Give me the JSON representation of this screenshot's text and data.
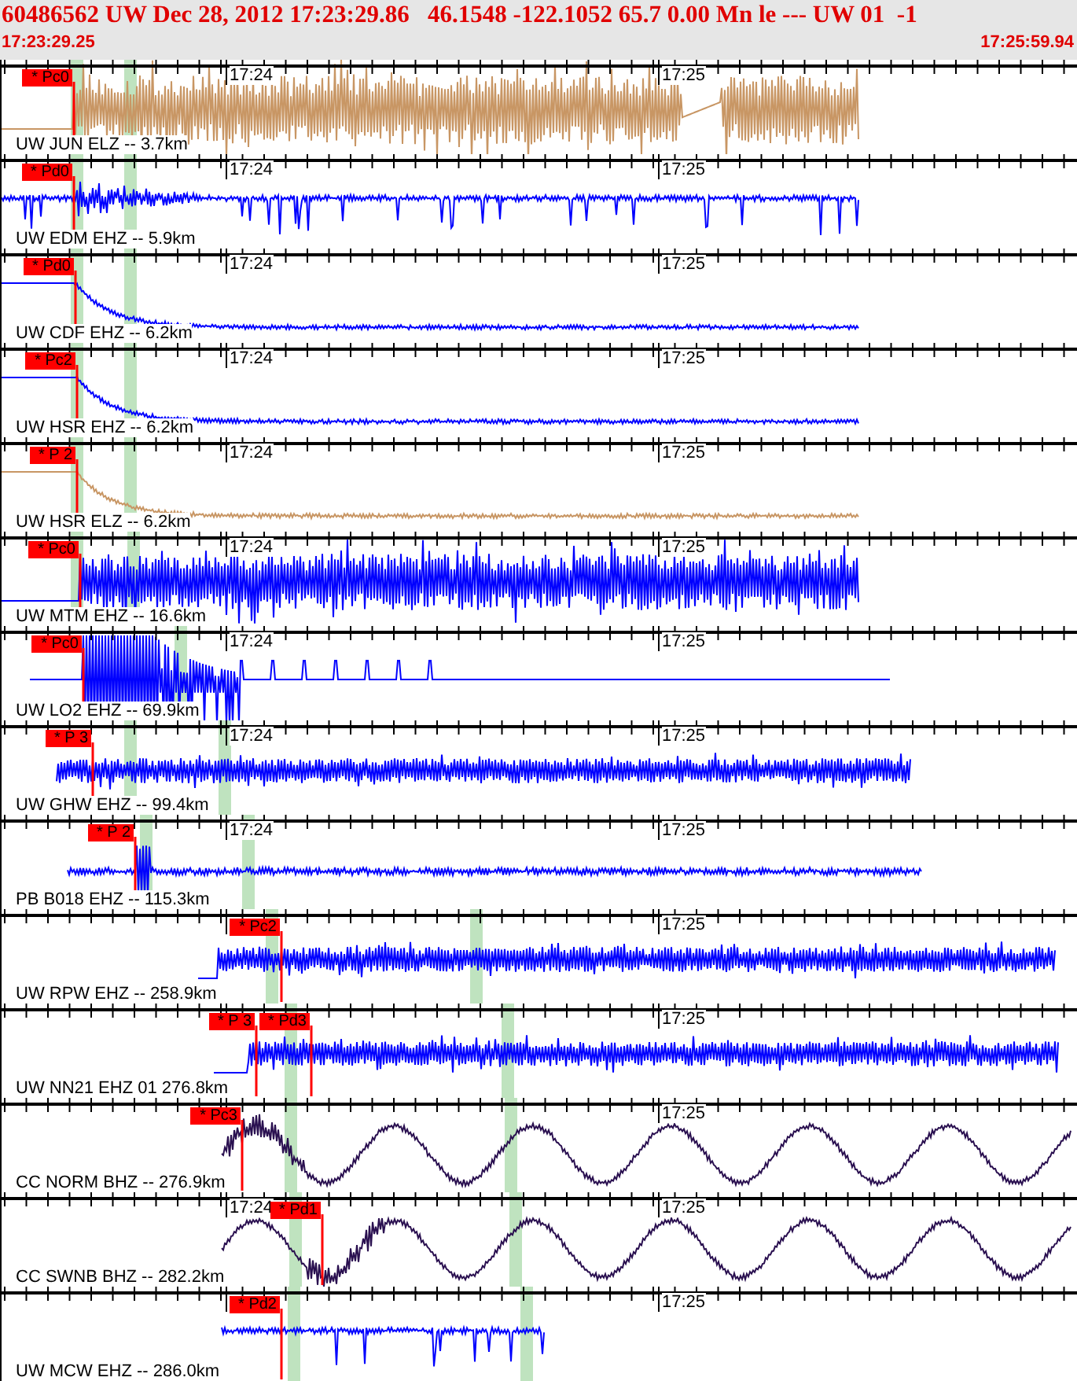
{
  "header": {
    "title": "60486562 UW Dec 28, 2012 17:23:29.86   46.1548 -122.1052 65.7 0.00 Mn le --- UW 01  -1",
    "start_time": "17:23:29.25",
    "end_time": "17:25:59.94"
  },
  "traces": [
    {
      "station": "UW JUN ELZ -- 3.7km",
      "kind": "noise",
      "color": "#c89664",
      "time_labels": [
        "17:24",
        "17:25"
      ],
      "picks": [
        "* Pc0"
      ]
    },
    {
      "station": "UW EDM EHZ -- 5.9km",
      "kind": "spikes",
      "color": "#0000ff",
      "time_labels": [
        "17:24",
        "17:25"
      ],
      "picks": [
        "* Pd0"
      ]
    },
    {
      "station": "UW CDF EHZ -- 6.2km",
      "kind": "decay",
      "color": "#0000ff",
      "time_labels": [
        "17:24",
        "17:25"
      ],
      "picks": [
        "* Pd0"
      ]
    },
    {
      "station": "UW HSR EHZ -- 6.2km",
      "kind": "decay",
      "color": "#0000ff",
      "time_labels": [
        "17:24",
        "17:25"
      ],
      "picks": [
        "* Pc2"
      ]
    },
    {
      "station": "UW HSR ELZ -- 6.2km",
      "kind": "decay",
      "color": "#c89664",
      "time_labels": [
        "17:24",
        "17:25"
      ],
      "picks": [
        "* P 2"
      ]
    },
    {
      "station": "UW MTM EHZ -- 16.6km",
      "kind": "noise",
      "color": "#0000ff",
      "time_labels": [
        "17:24",
        "17:25"
      ],
      "picks": [
        "* Pc0"
      ]
    },
    {
      "station": "UW LO2 EHZ -- 69.9km",
      "kind": "burst",
      "color": "#0000ff",
      "time_labels": [
        "17:24",
        "17:25"
      ],
      "picks": [
        "* Pc0"
      ]
    },
    {
      "station": "UW GHW EHZ -- 99.4km",
      "kind": "noise",
      "color": "#0000ff",
      "time_labels": [
        "17:24",
        "17:25"
      ],
      "picks": [
        "* P 3"
      ]
    },
    {
      "station": "PB B018 EHZ -- 115.3km",
      "kind": "quiet",
      "color": "#0000ff",
      "time_labels": [
        "17:24",
        "17:25"
      ],
      "picks": [
        "* P 2"
      ]
    },
    {
      "station": "UW RPW EHZ -- 258.9km",
      "kind": "noise",
      "color": "#0000ff",
      "time_labels": [
        "17:25"
      ],
      "picks": [
        "* Pc2"
      ]
    },
    {
      "station": "UW NN21 EHZ 01 276.8km",
      "kind": "noise",
      "color": "#0000ff",
      "time_labels": [
        "17:25"
      ],
      "picks": [
        "* P 3",
        "* Pd3"
      ]
    },
    {
      "station": "CC NORM BHZ -- 276.9km",
      "kind": "wave",
      "color": "#2a1050",
      "time_labels": [
        "17:25"
      ],
      "picks": [
        "* Pc3"
      ]
    },
    {
      "station": "CC SWNB BHZ -- 282.2km",
      "kind": "wave",
      "color": "#2a1050",
      "time_labels": [
        "17:24",
        "17:25"
      ],
      "picks": [
        "* Pd1"
      ]
    },
    {
      "station": "UW MCW EHZ -- 286.0km",
      "kind": "spikes",
      "color": "#0000ff",
      "time_labels": [
        "17:25"
      ],
      "picks": [
        "* Pd2"
      ]
    }
  ]
}
